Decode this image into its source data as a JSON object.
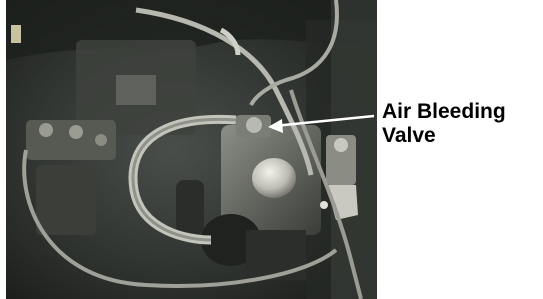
{
  "figure": {
    "callout": {
      "line1": "Air Bleeding",
      "line2": "Valve"
    },
    "colors": {
      "text": "#000000",
      "arrow": "#ffffff",
      "background": "#ffffff"
    }
  }
}
